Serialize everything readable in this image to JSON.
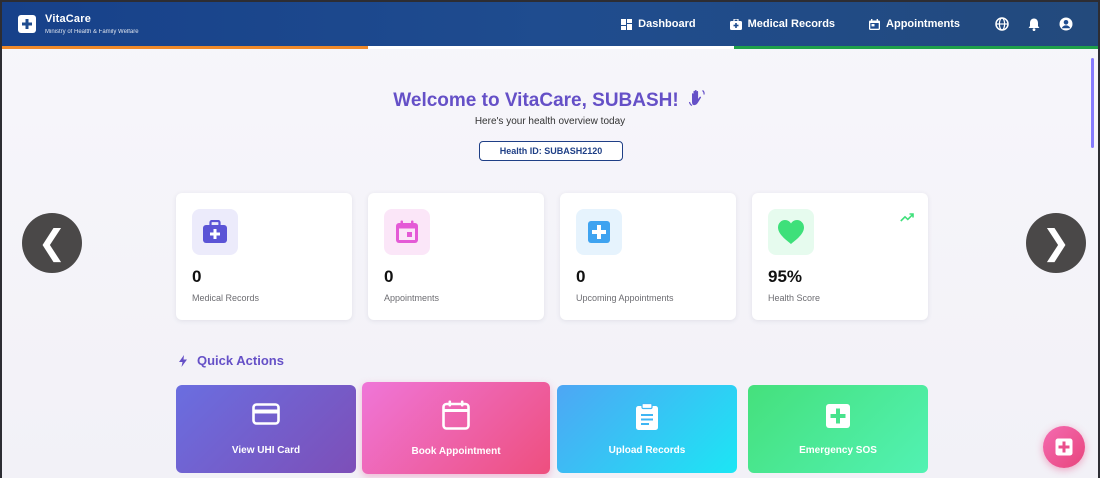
{
  "header": {
    "brand_title": "VitaCare",
    "brand_subtitle": "Ministry of Health & Family Welfare",
    "nav": [
      {
        "label": "Dashboard",
        "icon": "dashboard-icon"
      },
      {
        "label": "Medical Records",
        "icon": "medical-bag-icon"
      },
      {
        "label": "Appointments",
        "icon": "calendar-icon"
      }
    ],
    "utility_icons": [
      "globe-icon",
      "bell-icon",
      "user-icon"
    ]
  },
  "welcome": {
    "title": "Welcome to VitaCare, SUBASH!",
    "subtitle": "Here's your health overview today",
    "health_id": "Health ID: SUBASH2120"
  },
  "stats": [
    {
      "value": "0",
      "label": "Medical Records",
      "icon": "medical-bag-icon",
      "color": "#5b54d6",
      "bg": "#ecebfb"
    },
    {
      "value": "0",
      "label": "Appointments",
      "icon": "calendar-icon",
      "color": "#e45ad6",
      "bg": "#fbe6f8"
    },
    {
      "value": "0",
      "label": "Upcoming Appointments",
      "icon": "plus-square-icon",
      "color": "#3fa3f0",
      "bg": "#e6f3fd"
    },
    {
      "value": "95%",
      "label": "Health Score",
      "icon": "heart-icon",
      "color": "#3ee07a",
      "bg": "#e6fbee"
    }
  ],
  "carousel": {
    "prev": "❮",
    "next": "❯"
  },
  "quick_actions": {
    "title": "Quick Actions",
    "items": [
      {
        "label": "View UHI Card",
        "icon": "credit-card-icon",
        "gradient": [
          "#6a6ee0",
          "#7d4fb8"
        ]
      },
      {
        "label": "Book Appointment",
        "icon": "calendar-icon",
        "gradient": [
          "#ef76d8",
          "#ee4f7e"
        ]
      },
      {
        "label": "Upload Records",
        "icon": "clipboard-icon",
        "gradient": [
          "#4ea6f4",
          "#1ce6f4"
        ]
      },
      {
        "label": "Emergency SOS",
        "icon": "plus-square-icon",
        "gradient": [
          "#45e07c",
          "#52f2b3"
        ]
      }
    ]
  },
  "colors": {
    "accent": "#6550c7",
    "header": "#1f4c8f"
  }
}
